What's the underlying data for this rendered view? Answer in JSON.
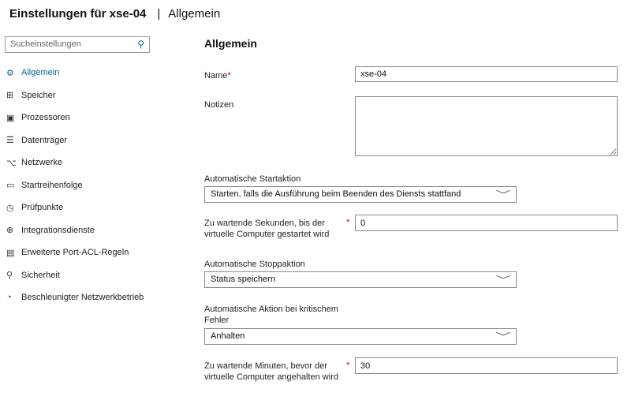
{
  "header": {
    "title_main": "Einstellungen für xse-04",
    "separator": "|",
    "title_section": "Allgemein"
  },
  "sidebar": {
    "search_placeholder": "Sucheinstellungen",
    "items": [
      {
        "label": "Allgemein",
        "icon": "⚙"
      },
      {
        "label": "Speicher",
        "icon": "⊞"
      },
      {
        "label": "Prozessoren",
        "icon": "▣"
      },
      {
        "label": "Datenträger",
        "icon": "☰"
      },
      {
        "label": "Netzwerke",
        "icon": "⌥"
      },
      {
        "label": "Startreihenfolge",
        "icon": "▭"
      },
      {
        "label": "Prüfpunkte",
        "icon": "◷"
      },
      {
        "label": "Integrationsdienste",
        "icon": "⊕"
      },
      {
        "label": "Erweiterte Port-ACL-Regeln",
        "icon": "▤"
      },
      {
        "label": "Sicherheit",
        "icon": "⚲"
      },
      {
        "label": "Beschleunigter Netzwerkbetrieb",
        "icon": "◔"
      }
    ]
  },
  "main": {
    "heading": "Allgemein",
    "name_label": "Name",
    "name_value": "xse-04",
    "notes_label": "Notizen",
    "notes_value": "",
    "start_action_label": "Automatische Startaktion",
    "start_action_value": "Starten, falls die Ausführung beim Beenden des Diensts stattfand",
    "start_delay_label_1": "Zu wartende Sekunden, bis der",
    "start_delay_label_2": "virtuelle Computer gestartet wird",
    "start_delay_value": "0",
    "stop_action_label": "Automatische Stoppaktion",
    "stop_action_value": "Status speichern",
    "critical_label_1": "Automatische Aktion bei kritischem",
    "critical_label_2": "Fehler",
    "critical_value": "Anhalten",
    "critical_delay_label_1": "Zu wartende Minuten, bevor der",
    "critical_delay_label_2": "virtuelle Computer angehalten wird",
    "critical_delay_value": "30",
    "required": "*",
    "chevron": "﹀"
  }
}
